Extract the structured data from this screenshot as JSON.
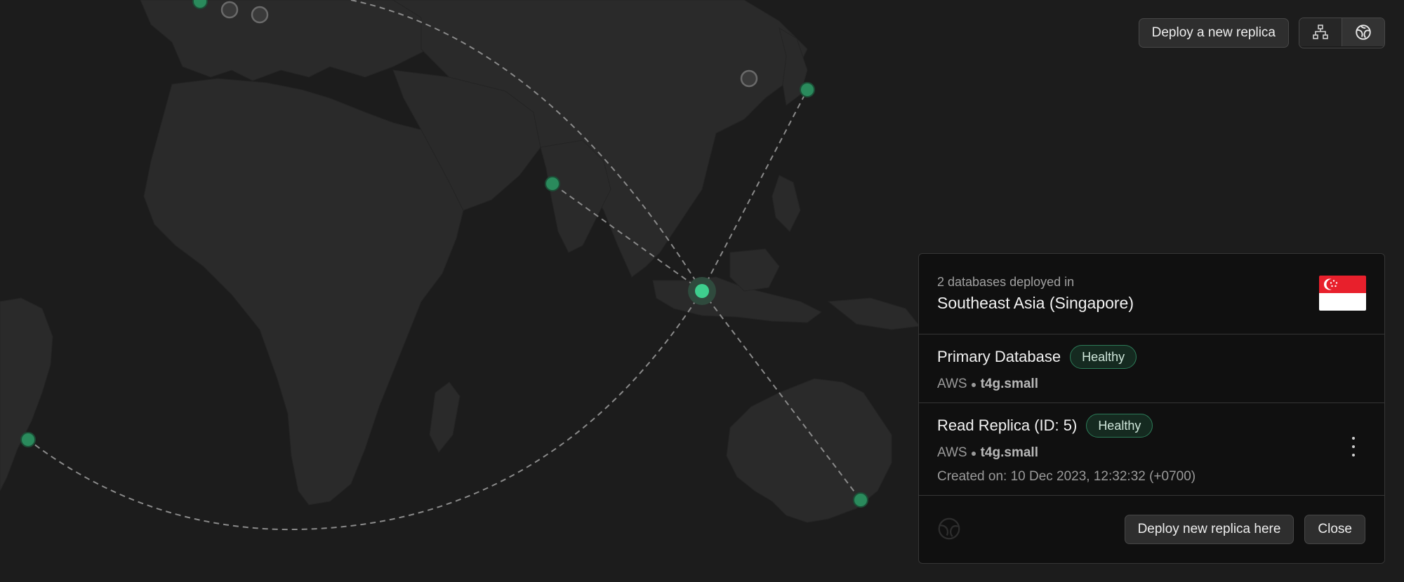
{
  "toolbar": {
    "deploy_label": "Deploy a new replica",
    "view_options": [
      {
        "icon": "network-diagram-icon",
        "active": false
      },
      {
        "icon": "globe-icon",
        "active": true
      }
    ]
  },
  "map": {
    "land_color": "#2a2a2a",
    "background_color": "#1c1c1c",
    "active_color": "#3ecf8e",
    "replica_color": "#2a8a5c",
    "inactive_color": "#5a5a5a"
  },
  "region_panel": {
    "subtitle": "2 databases deployed in",
    "region_name": "Southeast Asia (Singapore)",
    "flag_icon": "singapore-flag-icon",
    "databases": [
      {
        "title": "Primary Database",
        "status": "Healthy",
        "provider": "AWS",
        "separator": "●",
        "instance": "t4g.small"
      },
      {
        "title": "Read Replica (ID: 5)",
        "status": "Healthy",
        "provider": "AWS",
        "separator": "●",
        "instance": "t4g.small",
        "created": "Created on: 10 Dec 2023, 12:32:32 (+0700)"
      }
    ],
    "deploy_here_label": "Deploy new replica here",
    "close_label": "Close"
  }
}
